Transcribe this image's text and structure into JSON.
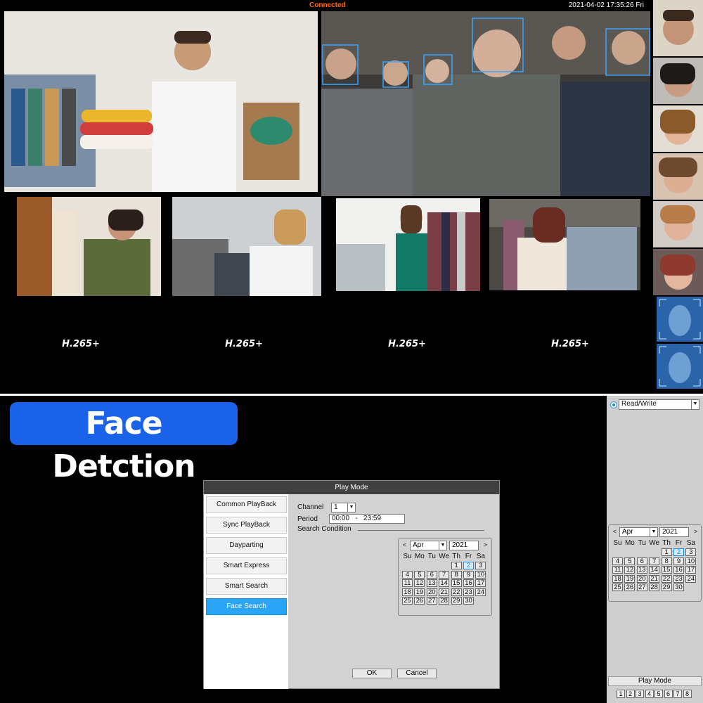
{
  "status": {
    "connection": "Connected",
    "datetime": "2021-04-02 17:35:26 Fri"
  },
  "feeds": {
    "codec_label": "H.265+"
  },
  "banner": {
    "title": "Face Detction"
  },
  "dialog": {
    "title": "Play Mode",
    "modes": [
      "Common PlayBack",
      "Sync PlayBack",
      "Dayparting",
      "Smart Express",
      "Smart Search",
      "Face Search"
    ],
    "selected_mode": "Face Search",
    "channel_label": "Channel",
    "channel_value": "1",
    "period_label": "Period",
    "period_value": "00:00   -   23:59",
    "search_condition_label": "Search Condition",
    "ok_label": "OK",
    "cancel_label": "Cancel"
  },
  "calendar": {
    "prev": "<",
    "next": ">",
    "month": "Apr",
    "year": "2021",
    "weekdays": [
      "Su",
      "Mo",
      "Tu",
      "We",
      "Th",
      "Fr",
      "Sa"
    ],
    "days": [
      "1",
      "2",
      "3",
      "4",
      "5",
      "6",
      "7",
      "8",
      "9",
      "10",
      "11",
      "12",
      "13",
      "14",
      "15",
      "16",
      "17",
      "18",
      "19",
      "20",
      "21",
      "22",
      "23",
      "24",
      "25",
      "26",
      "27",
      "28",
      "29",
      "30"
    ],
    "first_weekday_index": 4,
    "today": "2"
  },
  "side_panel": {
    "mode_value": "Read/Write",
    "play_mode_label": "Play Mode",
    "channels": [
      "1",
      "2",
      "3",
      "4",
      "5",
      "6",
      "7",
      "8"
    ]
  },
  "colors": {
    "accent": "#2aa5f5",
    "banner": "#1a63e8",
    "status_connected": "#ff6a00"
  }
}
